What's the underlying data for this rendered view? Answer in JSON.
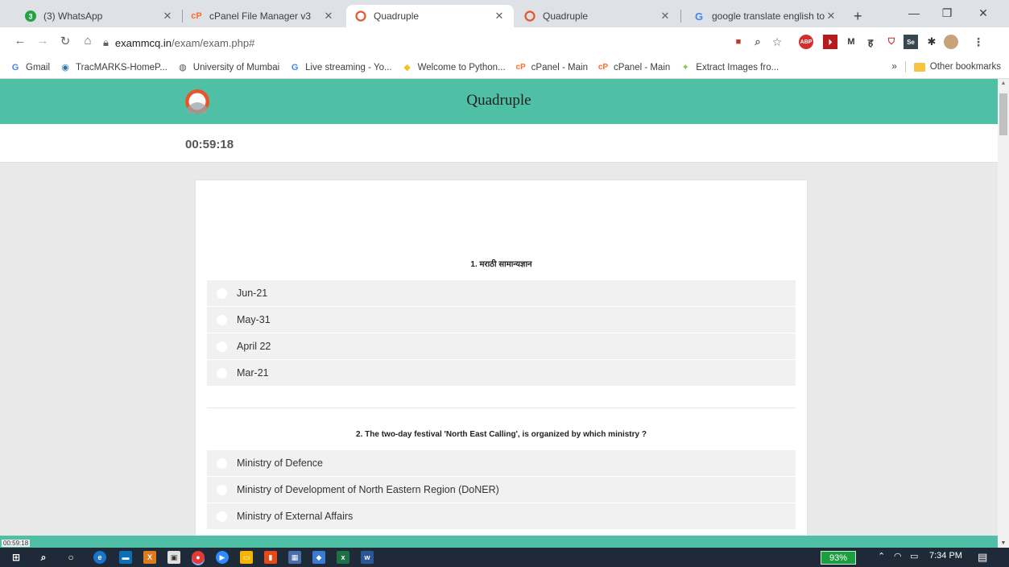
{
  "tabs": [
    {
      "title": "(3) WhatsApp",
      "badge": "3",
      "icon": "whatsapp-icon"
    },
    {
      "title": "cPanel File Manager v3",
      "icon": "cpanel-icon"
    },
    {
      "title": "Quadruple",
      "icon": "quadruple-icon",
      "active": true
    },
    {
      "title": "Quadruple",
      "icon": "quadruple-icon"
    },
    {
      "title": "google translate english to ma",
      "icon": "google-icon"
    }
  ],
  "toolbar": {
    "url_host": "exammcq.in",
    "url_path": "/exam/exam.php#"
  },
  "extensions": [
    "ABP",
    "M",
    "ह",
    "Se"
  ],
  "bookmarks": [
    {
      "label": "Gmail",
      "icon": "google-icon"
    },
    {
      "label": "TracMARKS-HomeP...",
      "icon": "tracmarks-icon"
    },
    {
      "label": "University of Mumbai",
      "icon": "globe-icon"
    },
    {
      "label": "Live streaming - Yo...",
      "icon": "google-icon"
    },
    {
      "label": "Welcome to Python...",
      "icon": "python-icon"
    },
    {
      "label": "cPanel - Main",
      "icon": "cpanel-icon"
    },
    {
      "label": "cPanel - Main",
      "icon": "cpanel-icon"
    },
    {
      "label": "Extract Images fro...",
      "icon": "extract-icon"
    }
  ],
  "bookmarks_overflow": "»",
  "other_bookmarks": "Other bookmarks",
  "site": {
    "title": "Quadruple",
    "timer": "00:59:18"
  },
  "questions": [
    {
      "text": "1. मराठी सामान्यज्ञान",
      "options": [
        "Jun-21",
        "May-31",
        " April 22",
        "Mar-21"
      ]
    },
    {
      "text": "2. The two-day festival 'North East Calling', is organized by which ministry ?",
      "options": [
        "Ministry of Defence",
        "Ministry of Development of North Eastern Region (DoNER)",
        "Ministry of External Affairs"
      ]
    }
  ],
  "status_timer": "00:59:18",
  "taskbar": {
    "battery": "93%",
    "time": "7:34 PM"
  },
  "colors": {
    "accent": "#4fbfa5",
    "tab_bg": "#dee1e6",
    "option_bg": "#f1f1f1"
  }
}
